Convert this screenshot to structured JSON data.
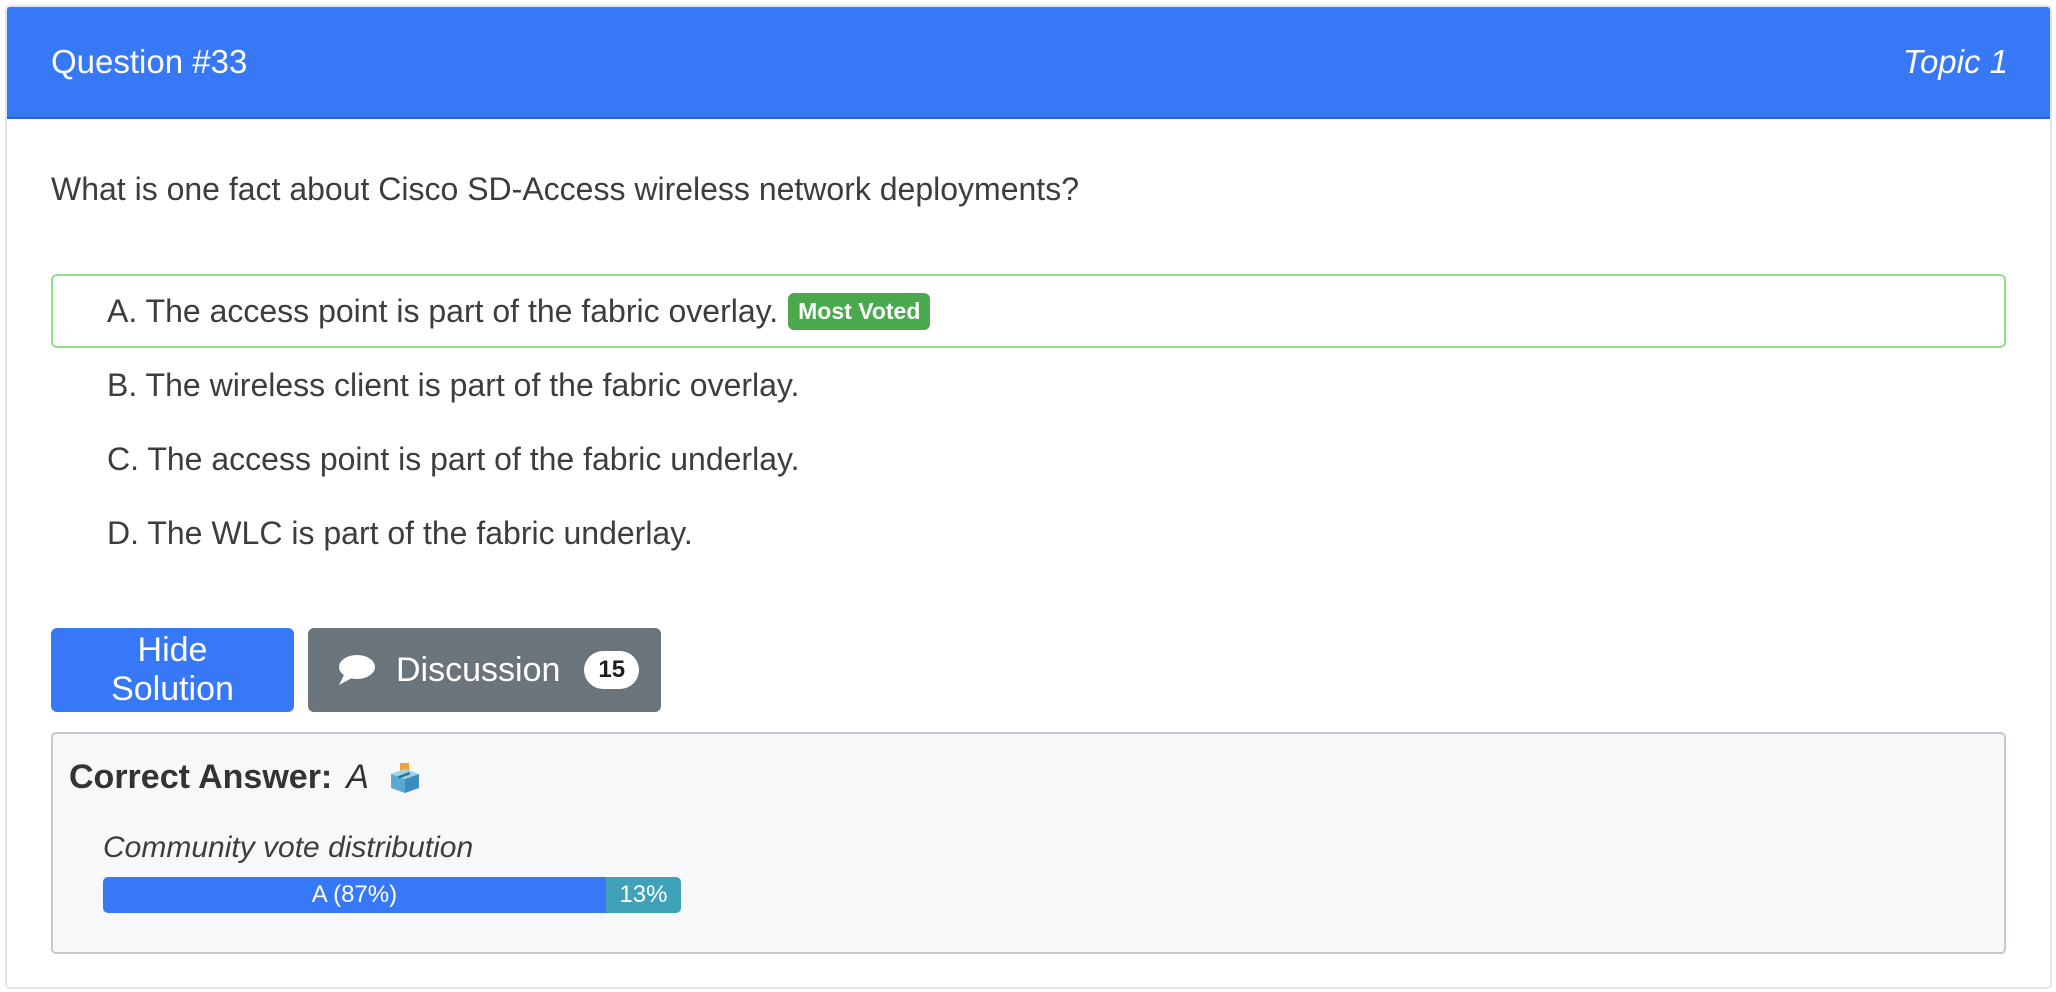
{
  "header": {
    "question_number": "Question #33",
    "topic": "Topic 1"
  },
  "question": {
    "text": "What is one fact about Cisco SD-Access wireless network deployments?"
  },
  "choices": [
    {
      "label": "A. The access point is part of the fabric overlay.",
      "badge": "Most Voted"
    },
    {
      "label": "B. The wireless client is part of the fabric overlay."
    },
    {
      "label": "C. The access point is part of the fabric underlay."
    },
    {
      "label": "D. The WLC is part of the fabric underlay."
    }
  ],
  "buttons": {
    "hide_solution": "Hide Solution",
    "discussion": "Discussion",
    "discussion_count": "15"
  },
  "answer": {
    "label": "Correct Answer:",
    "value": "A",
    "icon": "ballot-box-icon"
  },
  "vote_distribution": {
    "title": "Community vote distribution",
    "segments": [
      {
        "label": "A (87%)",
        "percent": 87
      },
      {
        "label": "13%",
        "percent": 13
      }
    ]
  },
  "colors": {
    "primary": "#3678f5",
    "secondary": "#6b737b",
    "most_voted": "#4aa84d",
    "vote_other": "#3fa2b8"
  }
}
